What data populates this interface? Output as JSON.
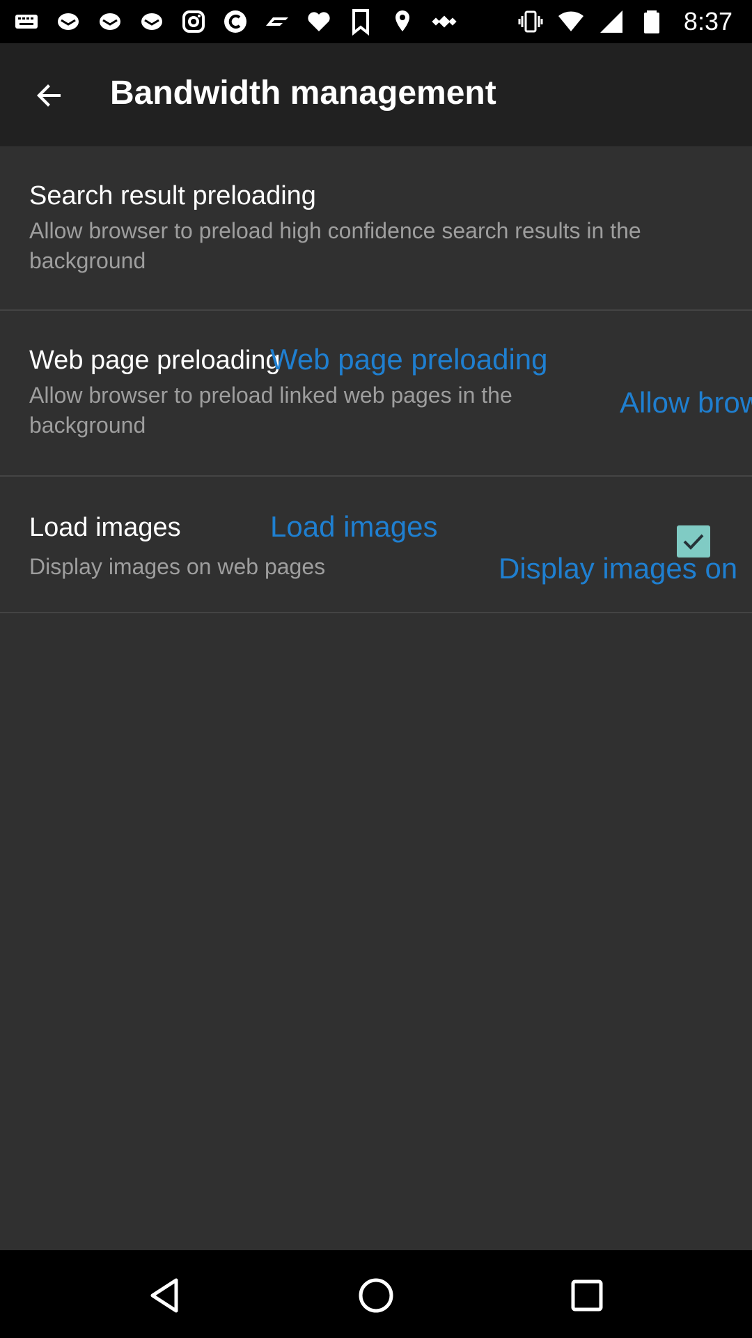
{
  "status_bar": {
    "time": "8:37",
    "left_icons": [
      "keyboard-icon",
      "mail-icon",
      "mail-icon",
      "mail-icon",
      "instagram-icon",
      "circle-c-icon",
      "f1-icon",
      "heart-icon",
      "bookmark-icon",
      "fake-gps-icon",
      "satellite-icon"
    ],
    "right_icons": [
      "vibrate-icon",
      "wifi-icon",
      "signal-icon",
      "battery-icon"
    ]
  },
  "app_bar": {
    "title": "Bandwidth management"
  },
  "preferences": [
    {
      "title": "Search result preloading",
      "summary": "Allow browser to preload high confidence search results in the background"
    },
    {
      "title": "Web page preloading",
      "summary": "Allow browser to preload linked web pages in the background",
      "ghost_title": "Web page preloading",
      "ghost_summary": "Allow brow"
    },
    {
      "title": "Load images",
      "summary": "Display images on web pages",
      "ghost_title": "Load images",
      "ghost_summary": "Display images on",
      "checked": true
    }
  ],
  "colors": {
    "background": "#303030",
    "app_bar": "#212121",
    "accent_text": "#1f7fd0",
    "checkbox": "#80cbc4"
  }
}
